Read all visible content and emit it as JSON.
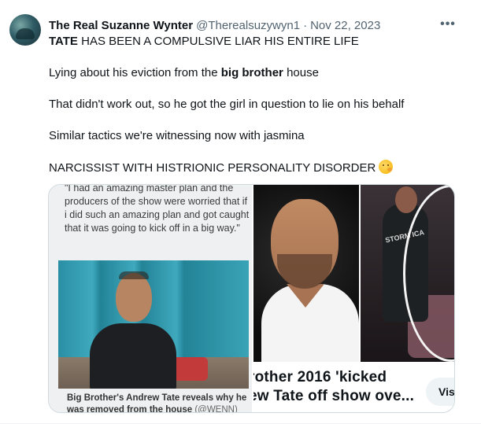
{
  "author": {
    "display_name": "The Real Suzanne Wynter",
    "handle": "@Therealsuzywyn1",
    "separator": "·",
    "date": "Nov 22, 2023"
  },
  "more_label": "•••",
  "tweet": {
    "line1_bold": "TATE",
    "line1_rest": " HAS BEEN A COMPULSIVE LIAR HIS ENTIRE LIFE",
    "line2_before": "Lying about his eviction from the ",
    "line2_bold": "big brother",
    "line2_after": " house",
    "line3": "That didn't work out, so he got the girl in question to lie on his behalf",
    "line4": "Similar tactics we're witnessing now with jasmina",
    "line5": "NARCISSIST WITH HISTRIONIC PERSONALITY DISORDER",
    "emoji": "thinking-face-emoji"
  },
  "media": {
    "article_quote": "\"I had an amazing master plan and the producers of the show were worried that if i did such an amazing plan and got caught that it was going to kick off in a big way.\"",
    "article_caption": "Big Brother's Andrew Tate reveals why he was removed from the house",
    "article_credit": " (@WENN)",
    "shirt_print": "STORM ICA"
  },
  "link_card": {
    "title": "rother 2016 'kicked\new Tate off show ove...",
    "visit_label": "Vis"
  }
}
